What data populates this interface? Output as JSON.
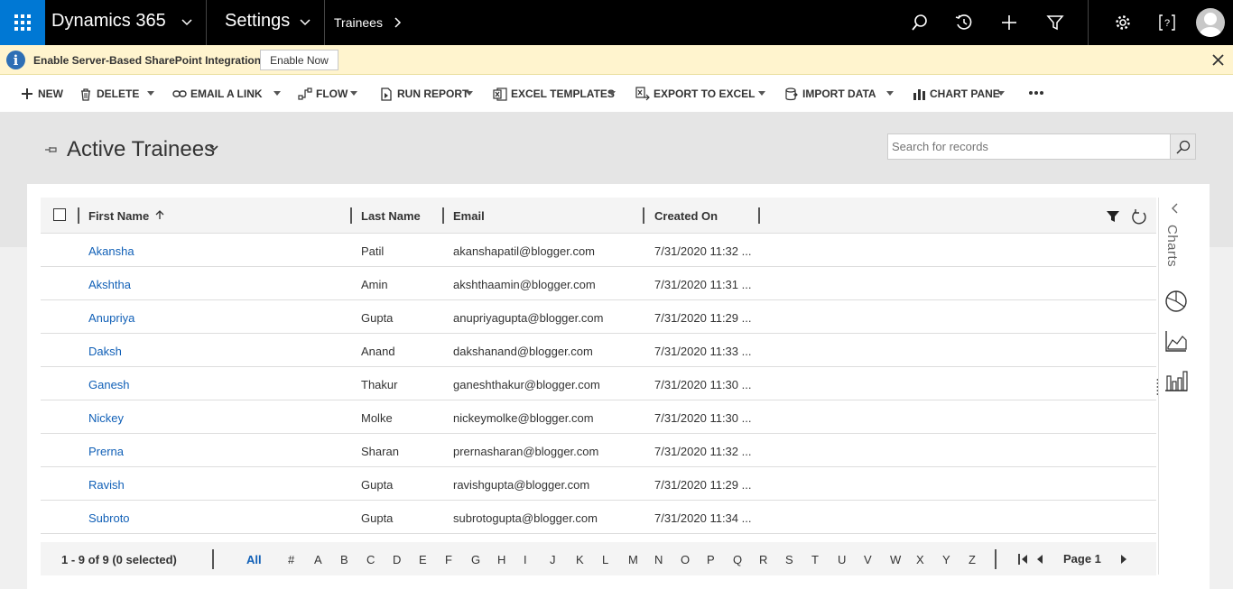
{
  "topnav": {
    "app_title": "Dynamics 365",
    "area_title": "Settings",
    "breadcrumb": "Trainees",
    "icons": [
      "search-icon",
      "recent-icon",
      "add-icon",
      "filter-icon",
      "gear-icon",
      "help-icon",
      "avatar"
    ]
  },
  "notification": {
    "message": "Enable Server-Based SharePoint Integration",
    "button_label": "Enable Now"
  },
  "commandbar": {
    "new": "NEW",
    "delete": "DELETE",
    "email_link": "EMAIL A LINK",
    "flow": "FLOW",
    "run_report": "RUN REPORT",
    "excel_templates": "EXCEL TEMPLATES",
    "export_excel": "EXPORT TO EXCEL",
    "import_data": "IMPORT DATA",
    "chart_pane": "CHART PANE"
  },
  "view": {
    "title": "Active Trainees",
    "search_placeholder": "Search for records"
  },
  "grid": {
    "columns": {
      "first_name": "First Name",
      "last_name": "Last Name",
      "email": "Email",
      "created_on": "Created On"
    },
    "rows": [
      {
        "first": "Akansha",
        "last": "Patil",
        "email": "akanshapatil@blogger.com",
        "created": "7/31/2020 11:32 ..."
      },
      {
        "first": "Akshtha",
        "last": "Amin",
        "email": "akshthaamin@blogger.com",
        "created": "7/31/2020 11:31 ..."
      },
      {
        "first": "Anupriya",
        "last": "Gupta",
        "email": "anupriyagupta@blogger.com",
        "created": "7/31/2020 11:29 ..."
      },
      {
        "first": "Daksh",
        "last": "Anand",
        "email": "dakshanand@blogger.com",
        "created": "7/31/2020 11:33 ..."
      },
      {
        "first": "Ganesh",
        "last": "Thakur",
        "email": "ganeshthakur@blogger.com",
        "created": "7/31/2020 11:30 ..."
      },
      {
        "first": "Nickey",
        "last": "Molke",
        "email": "nickeymolke@blogger.com",
        "created": "7/31/2020 11:30 ..."
      },
      {
        "first": "Prerna",
        "last": "Sharan",
        "email": "prernasharan@blogger.com",
        "created": "7/31/2020 11:32 ..."
      },
      {
        "first": "Ravish",
        "last": "Gupta",
        "email": "ravishgupta@blogger.com",
        "created": "7/31/2020 11:29 ..."
      },
      {
        "first": "Subroto",
        "last": "Gupta",
        "email": "subrotogupta@blogger.com",
        "created": "7/31/2020 11:34 ..."
      }
    ]
  },
  "sidepane": {
    "label": "Charts"
  },
  "footer": {
    "record_count": "1 - 9 of 9 (0 selected)",
    "letters": [
      "All",
      "#",
      "A",
      "B",
      "C",
      "D",
      "E",
      "F",
      "G",
      "H",
      "I",
      "J",
      "K",
      "L",
      "M",
      "N",
      "O",
      "P",
      "Q",
      "R",
      "S",
      "T",
      "U",
      "V",
      "W",
      "X",
      "Y",
      "Z"
    ],
    "page_label": "Page 1"
  },
  "colors": {
    "accent": "#0078d4",
    "link": "#1160b7",
    "notification_bg": "#fff4ce"
  }
}
